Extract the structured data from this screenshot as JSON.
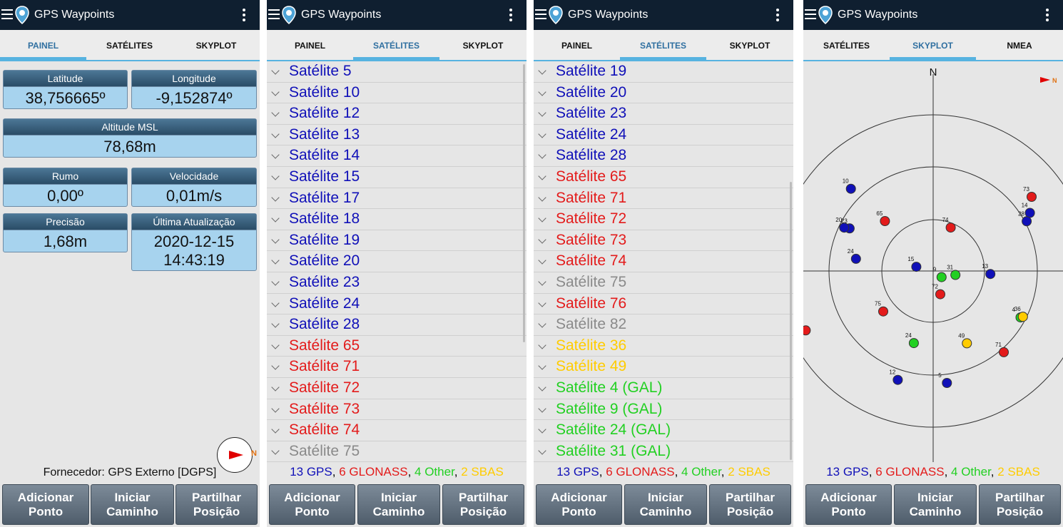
{
  "app": {
    "title": "GPS Waypoints"
  },
  "tabs": {
    "painel": "PAINEL",
    "satelites": "SATÉLITES",
    "skyplot": "SKYPLOT",
    "nmea": "NMEA"
  },
  "dashboard": {
    "latitude": {
      "label": "Latitude",
      "value": "38,756665º"
    },
    "longitude": {
      "label": "Longitude",
      "value": "-9,152874º"
    },
    "altitude": {
      "label": "Altitude MSL",
      "value": "78,68m"
    },
    "rumo": {
      "label": "Rumo",
      "value": "0,00º"
    },
    "velocidade": {
      "label": "Velocidade",
      "value": "0,01m/s"
    },
    "precisao": {
      "label": "Precisão",
      "value": "1,68m"
    },
    "ultima": {
      "label": "Última Atualização",
      "date": "2020-12-15",
      "time": "14:43:19"
    },
    "provider": "Fornecedor: GPS Externo [DGPS]",
    "compass_label": "N"
  },
  "colors": {
    "gps": "#1010b8",
    "glonass": "#e31b1b",
    "other": "#22d022",
    "sbas": "#ffcc00",
    "inactive": "#8a8a8a"
  },
  "satellites_list_a": [
    {
      "name": "Satélite 5",
      "type": "gps"
    },
    {
      "name": "Satélite 10",
      "type": "gps"
    },
    {
      "name": "Satélite 12",
      "type": "gps"
    },
    {
      "name": "Satélite 13",
      "type": "gps"
    },
    {
      "name": "Satélite 14",
      "type": "gps"
    },
    {
      "name": "Satélite 15",
      "type": "gps"
    },
    {
      "name": "Satélite 17",
      "type": "gps"
    },
    {
      "name": "Satélite 18",
      "type": "gps"
    },
    {
      "name": "Satélite 19",
      "type": "gps"
    },
    {
      "name": "Satélite 20",
      "type": "gps"
    },
    {
      "name": "Satélite 23",
      "type": "gps"
    },
    {
      "name": "Satélite 24",
      "type": "gps"
    },
    {
      "name": "Satélite 28",
      "type": "gps"
    },
    {
      "name": "Satélite 65",
      "type": "glonass"
    },
    {
      "name": "Satélite 71",
      "type": "glonass"
    },
    {
      "name": "Satélite 72",
      "type": "glonass"
    },
    {
      "name": "Satélite 73",
      "type": "glonass"
    },
    {
      "name": "Satélite 74",
      "type": "glonass"
    },
    {
      "name": "Satélite 75",
      "type": "inactive"
    }
  ],
  "satellites_list_b": [
    {
      "name": "Satélite 19",
      "type": "gps"
    },
    {
      "name": "Satélite 20",
      "type": "gps"
    },
    {
      "name": "Satélite 23",
      "type": "gps"
    },
    {
      "name": "Satélite 24",
      "type": "gps"
    },
    {
      "name": "Satélite 28",
      "type": "gps"
    },
    {
      "name": "Satélite 65",
      "type": "glonass"
    },
    {
      "name": "Satélite 71",
      "type": "glonass"
    },
    {
      "name": "Satélite 72",
      "type": "glonass"
    },
    {
      "name": "Satélite 73",
      "type": "glonass"
    },
    {
      "name": "Satélite 74",
      "type": "glonass"
    },
    {
      "name": "Satélite 75",
      "type": "inactive"
    },
    {
      "name": "Satélite 76",
      "type": "glonass"
    },
    {
      "name": "Satélite 82",
      "type": "inactive"
    },
    {
      "name": "Satélite 36",
      "type": "sbas"
    },
    {
      "name": "Satélite 49",
      "type": "sbas"
    },
    {
      "name": "Satélite 4 (GAL)",
      "type": "other"
    },
    {
      "name": "Satélite 9 (GAL)",
      "type": "other"
    },
    {
      "name": "Satélite 24 (GAL)",
      "type": "other"
    },
    {
      "name": "Satélite 31 (GAL)",
      "type": "other"
    }
  ],
  "counts": {
    "gps": "13 GPS",
    "glonass": "6 GLONASS",
    "other": "4 Other",
    "sbas": "2 SBAS",
    "sep": ", "
  },
  "buttons": {
    "add_1": "Adicionar",
    "add_2": "Ponto",
    "path_1": "Iniciar",
    "path_2": "Caminho",
    "share_1": "Partilhar",
    "share_2": "Posição"
  },
  "skyplot": {
    "north_label": "N",
    "satellites": [
      {
        "id": "10",
        "type": "gps",
        "az": 315,
        "el": 23
      },
      {
        "id": "73",
        "type": "glonass",
        "az": 53,
        "el": 19
      },
      {
        "id": "14",
        "type": "gps",
        "az": 59,
        "el": 25
      },
      {
        "id": "28",
        "type": "gps",
        "az": 62,
        "el": 29
      },
      {
        "id": "23",
        "type": "gps",
        "az": 297,
        "el": 36
      },
      {
        "id": "20",
        "type": "gps",
        "az": 296,
        "el": 33
      },
      {
        "id": "65",
        "type": "glonass",
        "az": 316,
        "el": 50
      },
      {
        "id": "74",
        "type": "glonass",
        "az": 22,
        "el": 63
      },
      {
        "id": "15",
        "type": "gps",
        "az": 284,
        "el": 80
      },
      {
        "id": "9",
        "type": "other",
        "az": 126,
        "el": 84
      },
      {
        "id": "31",
        "type": "other",
        "az": 100,
        "el": 77
      },
      {
        "id": "24",
        "type": "gps",
        "az": 279,
        "el": 45
      },
      {
        "id": "13",
        "type": "gps",
        "az": 93,
        "el": 57
      },
      {
        "id": "72",
        "type": "glonass",
        "az": 163,
        "el": 76
      },
      {
        "id": "75",
        "type": "glonass",
        "az": 231,
        "el": 53
      },
      {
        "id": "24",
        "type": "other",
        "az": 195,
        "el": 47
      },
      {
        "id": "49",
        "type": "sbas",
        "az": 155,
        "el": 44
      },
      {
        "id": "4",
        "type": "other",
        "az": 118,
        "el": 33
      },
      {
        "id": "36",
        "type": "sbas",
        "az": 117,
        "el": 32
      },
      {
        "id": "71",
        "type": "glonass",
        "az": 139,
        "el": 28
      },
      {
        "id": "76",
        "type": "glonass",
        "az": 245,
        "el": 9
      },
      {
        "id": "12",
        "type": "gps",
        "az": 198,
        "el": 24
      },
      {
        "id": "5",
        "type": "gps",
        "az": 173,
        "el": 25
      }
    ]
  }
}
